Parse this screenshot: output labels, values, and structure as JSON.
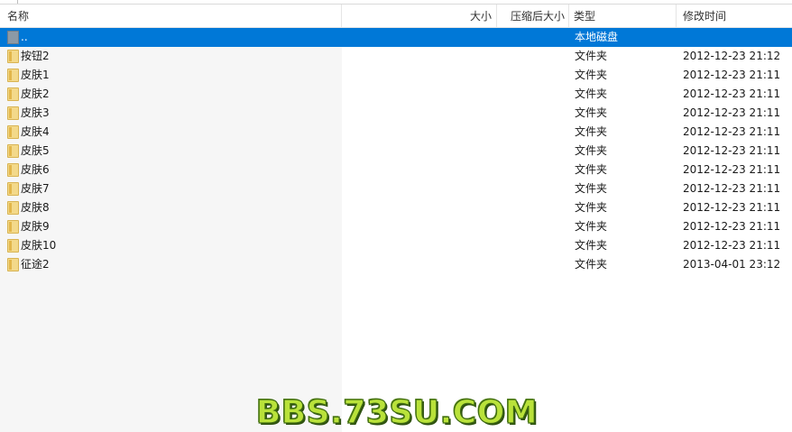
{
  "columns": {
    "name": "名称",
    "size": "大小",
    "compressed_size": "压缩后大小",
    "type": "类型",
    "modified": "修改时间"
  },
  "rows": [
    {
      "name": "..",
      "type": "本地磁盘",
      "modified": "",
      "icon": "up-folder-icon",
      "selected": true
    },
    {
      "name": "按钮2",
      "type": "文件夹",
      "modified": "2012-12-23 21:12",
      "icon": "folder-icon"
    },
    {
      "name": "皮肤1",
      "type": "文件夹",
      "modified": "2012-12-23 21:11",
      "icon": "folder-icon"
    },
    {
      "name": "皮肤2",
      "type": "文件夹",
      "modified": "2012-12-23 21:11",
      "icon": "folder-icon"
    },
    {
      "name": "皮肤3",
      "type": "文件夹",
      "modified": "2012-12-23 21:11",
      "icon": "folder-icon"
    },
    {
      "name": "皮肤4",
      "type": "文件夹",
      "modified": "2012-12-23 21:11",
      "icon": "folder-icon"
    },
    {
      "name": "皮肤5",
      "type": "文件夹",
      "modified": "2012-12-23 21:11",
      "icon": "folder-icon"
    },
    {
      "name": "皮肤6",
      "type": "文件夹",
      "modified": "2012-12-23 21:11",
      "icon": "folder-icon"
    },
    {
      "name": "皮肤7",
      "type": "文件夹",
      "modified": "2012-12-23 21:11",
      "icon": "folder-icon"
    },
    {
      "name": "皮肤8",
      "type": "文件夹",
      "modified": "2012-12-23 21:11",
      "icon": "folder-icon"
    },
    {
      "name": "皮肤9",
      "type": "文件夹",
      "modified": "2012-12-23 21:11",
      "icon": "folder-icon"
    },
    {
      "name": "皮肤10",
      "type": "文件夹",
      "modified": "2012-12-23 21:11",
      "icon": "folder-icon"
    },
    {
      "name": "征途2",
      "type": "文件夹",
      "modified": "2013-04-01 23:12",
      "icon": "folder-icon"
    }
  ],
  "watermark": "BBS.73SU.COM",
  "colors": {
    "selection": "#0078d7",
    "folder": "#f3d98a",
    "watermark_fill": "#b9e23a",
    "watermark_outline": "#3e6a12"
  }
}
